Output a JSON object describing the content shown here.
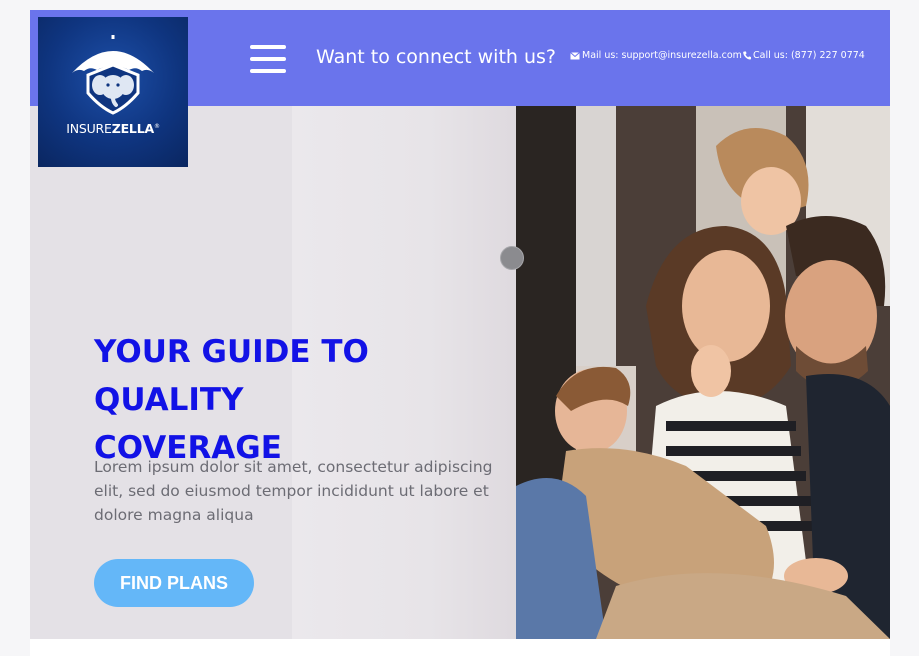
{
  "brand": {
    "name_regular": "INSURE",
    "name_bold": "ZELLA",
    "trademark": "®",
    "colors": {
      "topbar": "#6a74ec",
      "logo_bg": "#0f3580",
      "headline": "#1212e6",
      "cta": "#64b7f8"
    }
  },
  "header": {
    "menu_icon": "hamburger-menu-icon",
    "connect_text": "Want to connect with us?",
    "mail_icon": "envelope-icon",
    "mail_text": "Mail us: support@insurezella.com",
    "phone_icon": "phone-icon",
    "phone_text": "Call us: (877) 227 0774"
  },
  "hero": {
    "headline_line1": "YOUR GUIDE TO QUALITY",
    "headline_line2": "COVERAGE",
    "body_line1": "Lorem ipsum dolor sit amet, consectetur adipiscing",
    "body_line2": "elit, sed do eiusmod tempor incididunt ut labore et",
    "body_line3": "dolore magna aliqua",
    "cta_label": "FIND PLANS",
    "image_subject": "family-photo"
  }
}
